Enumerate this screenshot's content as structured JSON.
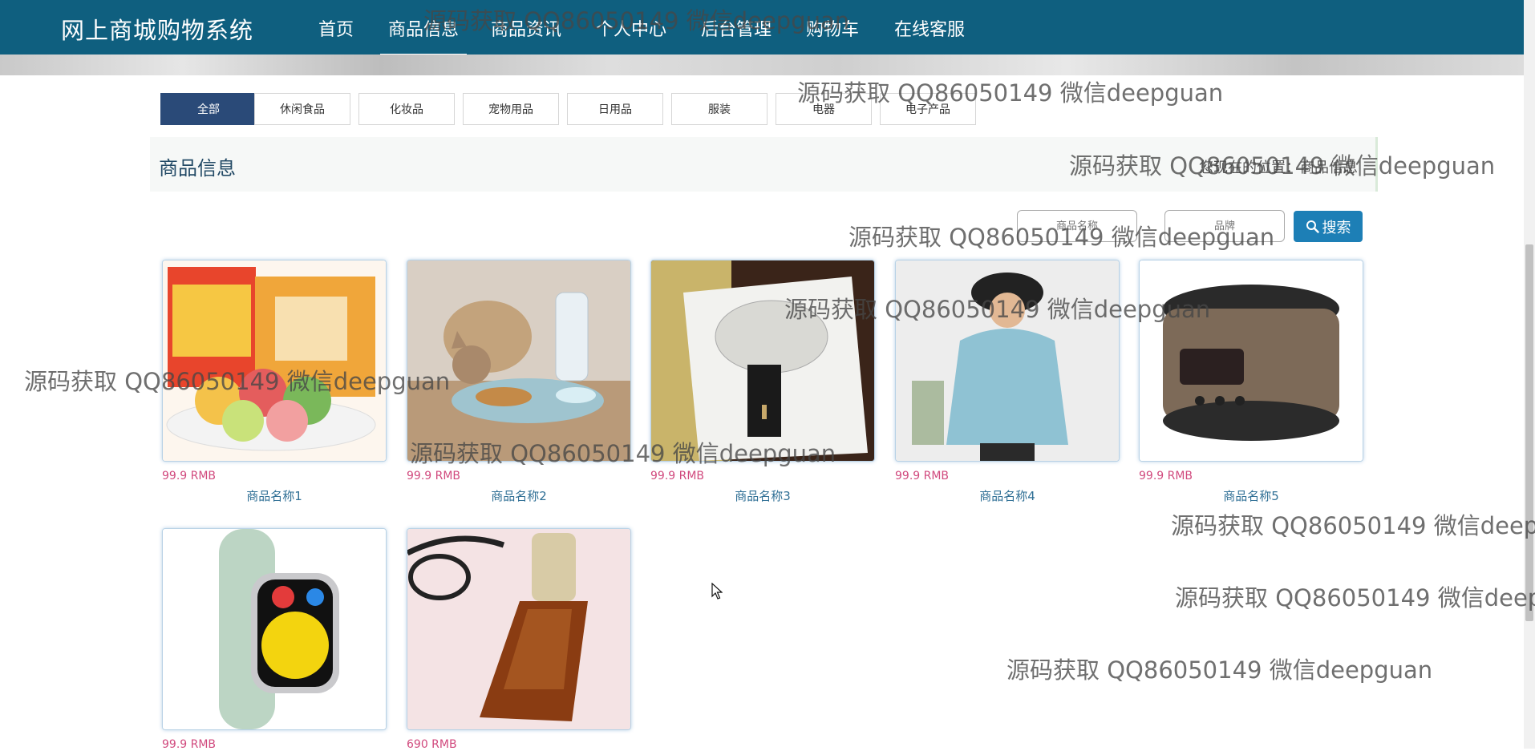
{
  "brand": "网上商城购物系统",
  "nav": [
    {
      "label": "首页"
    },
    {
      "label": "商品信息"
    },
    {
      "label": "商品资讯"
    },
    {
      "label": "个人中心"
    },
    {
      "label": "后台管理"
    },
    {
      "label": "购物车"
    },
    {
      "label": "在线客服"
    }
  ],
  "categories": [
    {
      "label": "全部"
    },
    {
      "label": "休闲食品"
    },
    {
      "label": "化妆品"
    },
    {
      "label": "宠物用品"
    },
    {
      "label": "日用品"
    },
    {
      "label": "服装"
    },
    {
      "label": "电器"
    },
    {
      "label": "电子产品"
    }
  ],
  "section": {
    "title": "商品信息",
    "breadcrumb": "您现在的位置：商品信息"
  },
  "search": {
    "name_placeholder": "商品名称",
    "brand_placeholder": "品牌",
    "button_label": "搜索"
  },
  "products": [
    {
      "price": "99.9 RMB",
      "name": "商品名称1",
      "image": "mooncake-gift-box"
    },
    {
      "price": "99.9 RMB",
      "name": "商品名称2",
      "image": "cat-pet-feeder"
    },
    {
      "price": "99.9 RMB",
      "name": "商品名称3",
      "image": "beauty-device"
    },
    {
      "price": "99.9 RMB",
      "name": "商品名称4",
      "image": "hoodie-model"
    },
    {
      "price": "99.9 RMB",
      "name": "商品名称5",
      "image": "rice-cooker"
    },
    {
      "price": "99.9 RMB",
      "name": "",
      "image": "smart-watch"
    },
    {
      "price": "690 RMB",
      "name": "",
      "image": "serum-bottle"
    }
  ],
  "watermark": "源码获取 QQ86050149 微信deepguan",
  "colors": {
    "nav_bg": "#0f5f7f",
    "category_active": "#2a4a78",
    "price": "#d14a7e",
    "link": "#2f6f95",
    "search_button": "#1d7fb6"
  }
}
